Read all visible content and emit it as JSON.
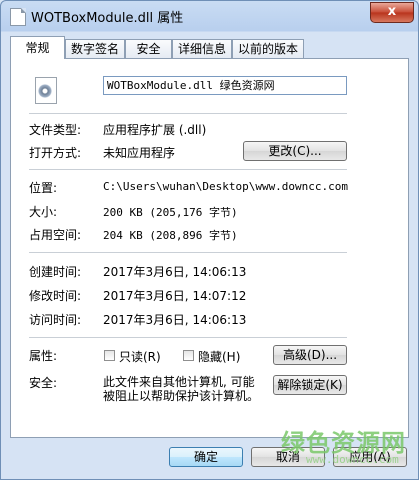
{
  "window": {
    "title": "WOTBoxModule.dll 属性",
    "close_label": "x"
  },
  "tabs": [
    {
      "label": "常规",
      "active": true
    },
    {
      "label": "数字签名",
      "active": false
    },
    {
      "label": "安全",
      "active": false
    },
    {
      "label": "详细信息",
      "active": false
    },
    {
      "label": "以前的版本",
      "active": false
    }
  ],
  "general": {
    "file_name": "WOTBoxModule.dll 绿色资源网",
    "file_type_label": "文件类型:",
    "file_type_value": "应用程序扩展 (.dll)",
    "opens_with_label": "打开方式:",
    "opens_with_value": "未知应用程序",
    "change_button": "更改(C)...",
    "location_label": "位置:",
    "location_value": "C:\\Users\\wuhan\\Desktop\\www.downcc.com",
    "size_label": "大小:",
    "size_value": "200 KB (205,176 字节)",
    "disk_size_label": "占用空间:",
    "disk_size_value": "204 KB (208,896 字节)",
    "created_label": "创建时间:",
    "created_value": "2017年3月6日, 14:06:13",
    "modified_label": "修改时间:",
    "modified_value": "2017年3月6日, 14:07:12",
    "accessed_label": "访问时间:",
    "accessed_value": "2017年3月6日, 14:06:13",
    "attributes_label": "属性:",
    "readonly_label": "只读(R)",
    "hidden_label": "隐藏(H)",
    "advanced_button": "高级(D)...",
    "security_label": "安全:",
    "security_line1": "此文件来自其他计算机, 可能",
    "security_line2": "被阻止以帮助保护该计算机。",
    "unblock_button": "解除锁定(K)"
  },
  "footer": {
    "ok_button": "确定",
    "cancel_button": "取消",
    "apply_button": "应用(A)"
  },
  "watermark": {
    "text": "绿色资源网",
    "url": "www.downcc.com"
  }
}
